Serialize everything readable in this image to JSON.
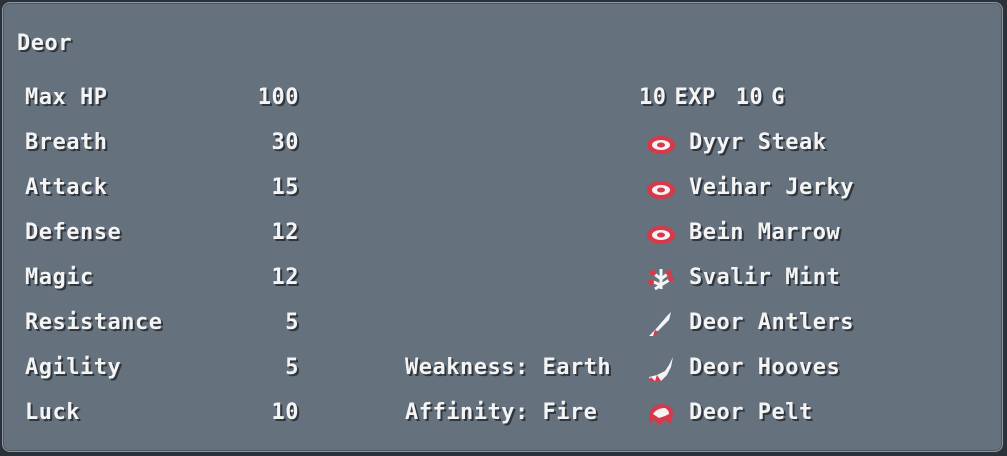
{
  "monster": {
    "name": "Deor"
  },
  "stats": [
    {
      "label": "Max HP",
      "value": "100"
    },
    {
      "label": "Breath",
      "value": "30"
    },
    {
      "label": "Attack",
      "value": "15"
    },
    {
      "label": "Defense",
      "value": "12"
    },
    {
      "label": "Magic",
      "value": "12"
    },
    {
      "label": "Resistance",
      "value": "5"
    },
    {
      "label": "Agility",
      "value": "5"
    },
    {
      "label": "Luck",
      "value": "10"
    }
  ],
  "rewards": {
    "exp": "10",
    "exp_label": "EXP",
    "gold": "10",
    "gold_label": "G"
  },
  "elements": {
    "weakness": "Weakness: Earth",
    "affinity": "Affinity: Fire"
  },
  "drops": [
    {
      "name": "Dyyr Steak",
      "icon": "meat-icon"
    },
    {
      "name": "Veihar Jerky",
      "icon": "meat-icon"
    },
    {
      "name": "Bein Marrow",
      "icon": "meat-icon"
    },
    {
      "name": "Svalir Mint",
      "icon": "herb-icon"
    },
    {
      "name": "Deor Antlers",
      "icon": "antler-icon"
    },
    {
      "name": "Deor Hooves",
      "icon": "hoof-icon"
    },
    {
      "name": "Deor Pelt",
      "icon": "pelt-icon"
    }
  ],
  "colors": {
    "panel": "#65717d",
    "text": "#f4f4f4",
    "icon_red": "#d8394a",
    "icon_white": "#f4f4f4"
  }
}
